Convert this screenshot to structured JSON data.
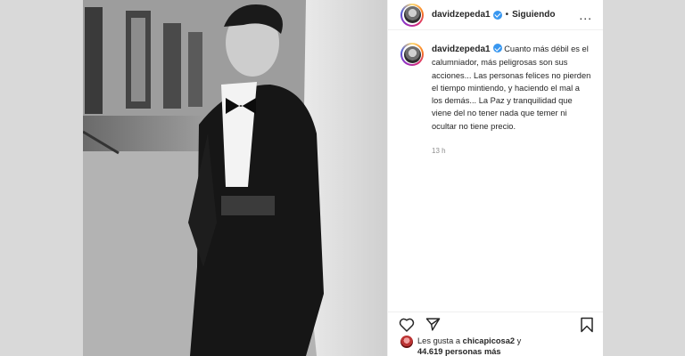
{
  "header": {
    "username": "davidzepeda1",
    "separator": "•",
    "follow_status": "Siguiendo",
    "more": "..."
  },
  "caption": {
    "username": "davidzepeda1",
    "text": "Cuanto más débil es el calumniador, más peligrosas son sus acciones... Las personas felices no pierden el tiempo mintiendo, y haciendo el mal a los demás... La Paz y tranquilidad que viene del no tener nada que temer ni ocultar no tiene precio.",
    "time": "13 h"
  },
  "actions": {
    "icons": [
      "heart-icon",
      "share-icon",
      "bookmark-icon"
    ]
  },
  "likes": {
    "prefix": "Les gusta a",
    "liker": "chicapicosa2",
    "connector": "y",
    "count": "44.619 personas más"
  },
  "photo": {
    "description_icon": "post-photo"
  },
  "colors": {
    "verified": "#3897f0",
    "text": "#262626",
    "muted": "#8e8e8e"
  }
}
